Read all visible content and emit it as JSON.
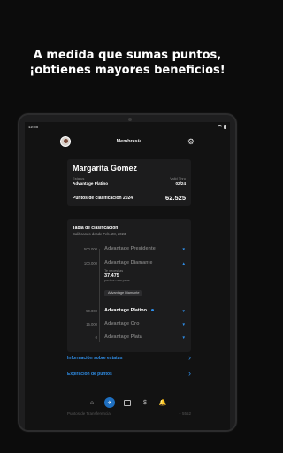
{
  "promo": {
    "line1": "A medida que sumas puntos,",
    "line2": "¡obtienes mayores beneficios!"
  },
  "status_bar": {
    "time": "12:38"
  },
  "app_bar": {
    "title": "Membresía"
  },
  "profile": {
    "name": "Margarita Gomez",
    "status_label": "Estatus",
    "status_value": "Advantage Platino",
    "valid_label": "Valid Thru",
    "valid_value": "02/24",
    "points_label": "Puntos de clasificacion 2024",
    "points_value": "62.525"
  },
  "table": {
    "title": "Tabla de clasificación",
    "subtitle": "Calificando desde Feb. 28, 2023",
    "tiers": [
      {
        "threshold": "500.000",
        "name": "Advantage Presidente"
      },
      {
        "threshold": "100.000",
        "name": "Advantage Diamante"
      },
      {
        "threshold": "50.000",
        "name": "Advantage Platino"
      },
      {
        "threshold": "15.000",
        "name": "Advantage Oro"
      },
      {
        "threshold": "0",
        "name": "Advantage Plata"
      }
    ],
    "need_label": "Te necesitas",
    "need_value": "37.475",
    "need_suffix": "puntos más para:",
    "need_chip": "Advantage Diamante"
  },
  "links": {
    "status_info": "Información sobre estatus",
    "points_expiry": "Expiración de puntos"
  },
  "faded_row": {
    "left": "Puntos de Transferencia",
    "right": "+ 5552"
  },
  "colors": {
    "accent": "#2f8ee8",
    "background": "#121212",
    "card": "#1c1c1d"
  }
}
